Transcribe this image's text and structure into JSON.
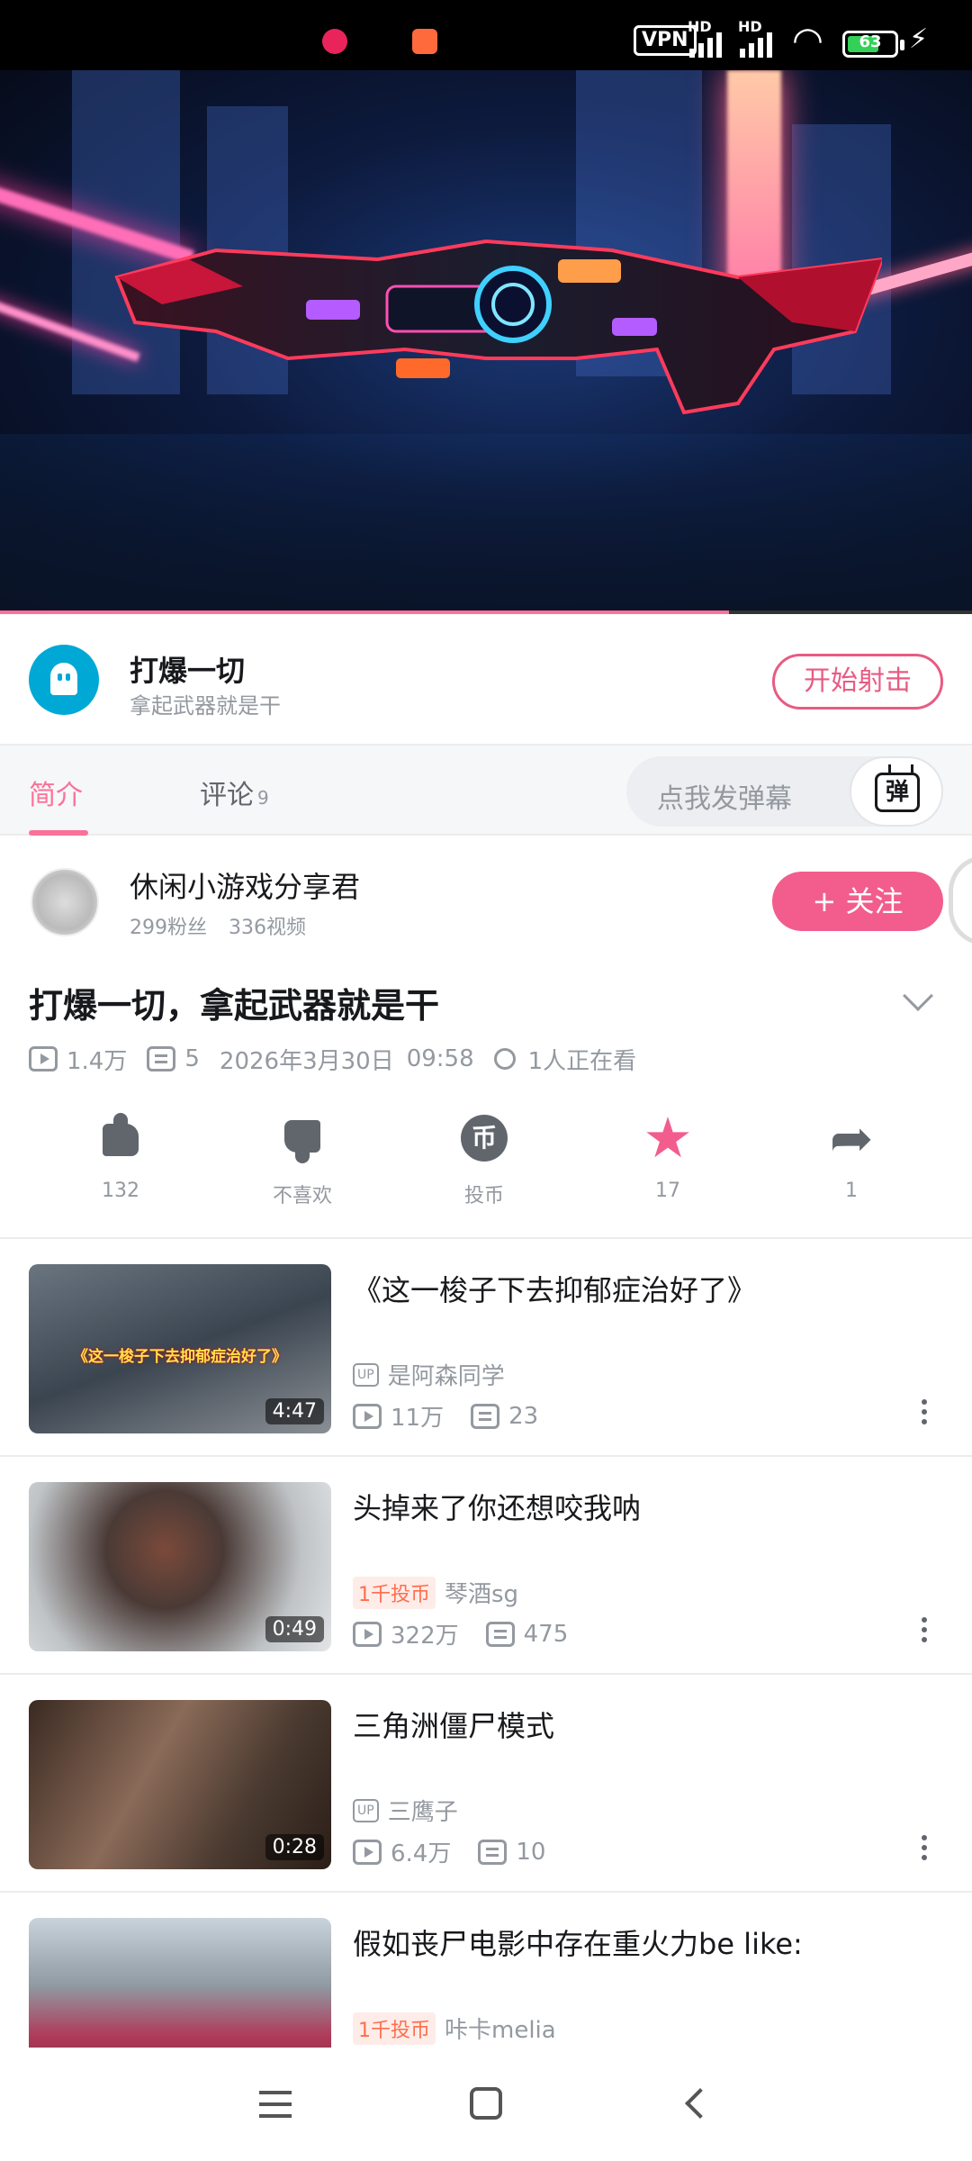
{
  "status_bar": {
    "vpn": "VPN",
    "hd1": "HD",
    "hd2": "HD",
    "battery": "63"
  },
  "player": {
    "progress": 0.75
  },
  "ad": {
    "title": "打爆一切",
    "subtitle": "拿起武器就是干",
    "button": "开始射击"
  },
  "tabs": {
    "intro": "简介",
    "comments": "评论",
    "comment_count": "9",
    "danmaku_placeholder": "点我发弹幕",
    "danmaku_button": "弹"
  },
  "uploader": {
    "name": "休闲小游戏分享君",
    "fans": "299粉丝",
    "videos": "336视频",
    "follow": "+ 关注"
  },
  "video": {
    "title": "打爆一切，拿起武器就是干",
    "views": "1.4万",
    "danmaku": "5",
    "date": "2026年3月30日",
    "time": "09:58",
    "watching": "1人正在看"
  },
  "actions": {
    "like": "132",
    "dislike": "不喜欢",
    "coin": "投币",
    "coin_glyph": "币",
    "favorite": "17",
    "share": "1"
  },
  "recommendations": [
    {
      "title": "《这一梭子下去抑郁症治好了》",
      "tag": "UP",
      "author": "是阿森同学",
      "views": "11万",
      "danmaku": "23",
      "duration": "4:47",
      "thumb_caption": "《这一梭子下去抑郁症治好了》"
    },
    {
      "title": "头掉来了你还想咬我呐",
      "tag": "1千投币",
      "author": "琴酒sg",
      "views": "322万",
      "danmaku": "475",
      "duration": "0:49"
    },
    {
      "title": "三角洲僵尸模式",
      "tag": "UP",
      "author": "三鹰子",
      "views": "6.4万",
      "danmaku": "10",
      "duration": "0:28"
    },
    {
      "title": "假如丧尸电影中存在重火力be like:",
      "tag": "1千投币",
      "author": "咔卡melia"
    }
  ],
  "colors": {
    "accent": "#fb7299",
    "follow": "#f25d8e",
    "ad_icon": "#00a8d6"
  }
}
